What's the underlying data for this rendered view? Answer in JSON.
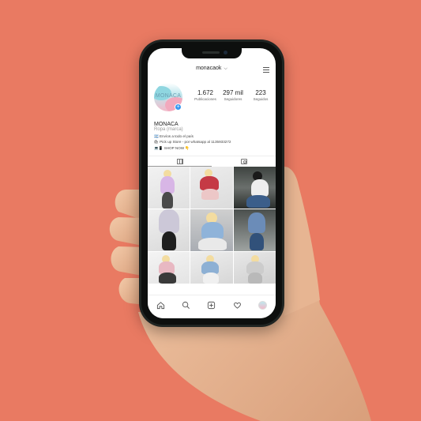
{
  "header": {
    "username": "monacaok"
  },
  "profile": {
    "avatar_text": "MONACA",
    "stats": [
      {
        "value": "1.672",
        "label": "Publicaciones"
      },
      {
        "value": "297 mil",
        "label": "Seguidores"
      },
      {
        "value": "223",
        "label": "Seguidos"
      }
    ],
    "name": "MONACA",
    "category": "Ropa (marca)",
    "bio_lines": [
      "🇦🇷 Envíos a todo el país",
      "🛍 Pick up Store - por whatsapp al 1135933272",
      "💻📱 SHOP NOW 👇"
    ]
  },
  "tabs": [
    "grid",
    "tagged"
  ],
  "icons": {
    "nav": [
      "home-icon",
      "search-icon",
      "add-post-icon",
      "heart-icon",
      "profile-avatar-icon"
    ]
  },
  "colors": {
    "background": "#e97a62",
    "accent": "#3897f0"
  }
}
